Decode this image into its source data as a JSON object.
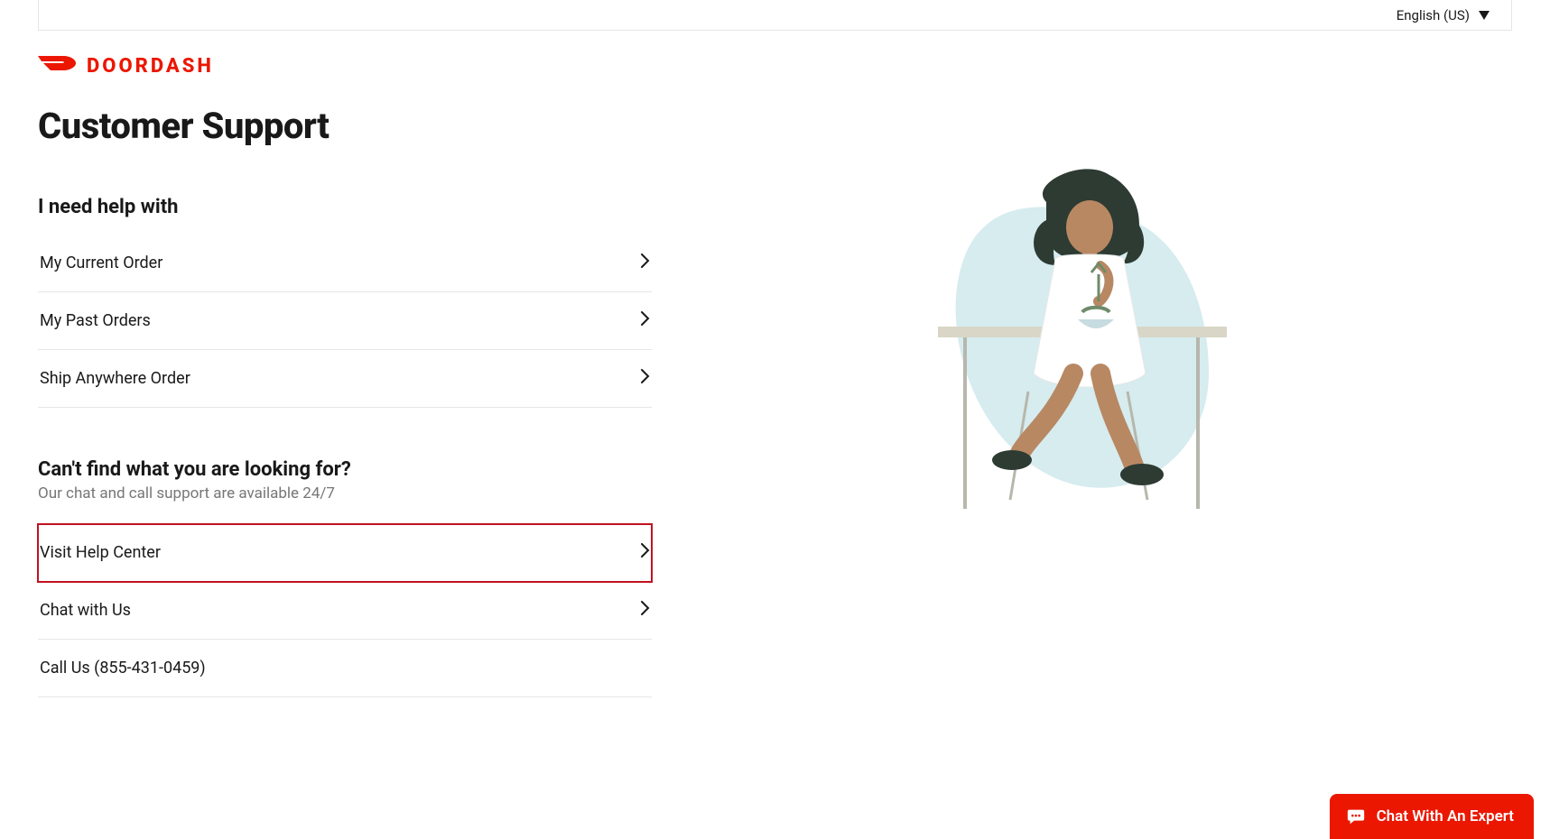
{
  "language_selector": {
    "label": "English (US)"
  },
  "brand": {
    "name": "DOORDASH"
  },
  "page_title": "Customer Support",
  "help_section": {
    "heading": "I need help with",
    "items": [
      {
        "label": "My Current Order"
      },
      {
        "label": "My Past Orders"
      },
      {
        "label": "Ship Anywhere Order"
      }
    ]
  },
  "not_found_section": {
    "heading": "Can't find what you are looking for?",
    "subtext": "Our chat and call support are available 24/7",
    "items": [
      {
        "label": "Visit Help Center",
        "highlighted": true,
        "has_arrow": true
      },
      {
        "label": "Chat with Us",
        "highlighted": false,
        "has_arrow": true
      },
      {
        "label": "Call Us (855-431-0459)",
        "highlighted": false,
        "has_arrow": false
      }
    ]
  },
  "chat_widget": {
    "label": "Chat With An Expert"
  },
  "colors": {
    "brand": "#eb1700",
    "highlight_border": "#c1121f",
    "text": "#191919",
    "muted": "#767676",
    "divider": "#e6e6e6"
  }
}
